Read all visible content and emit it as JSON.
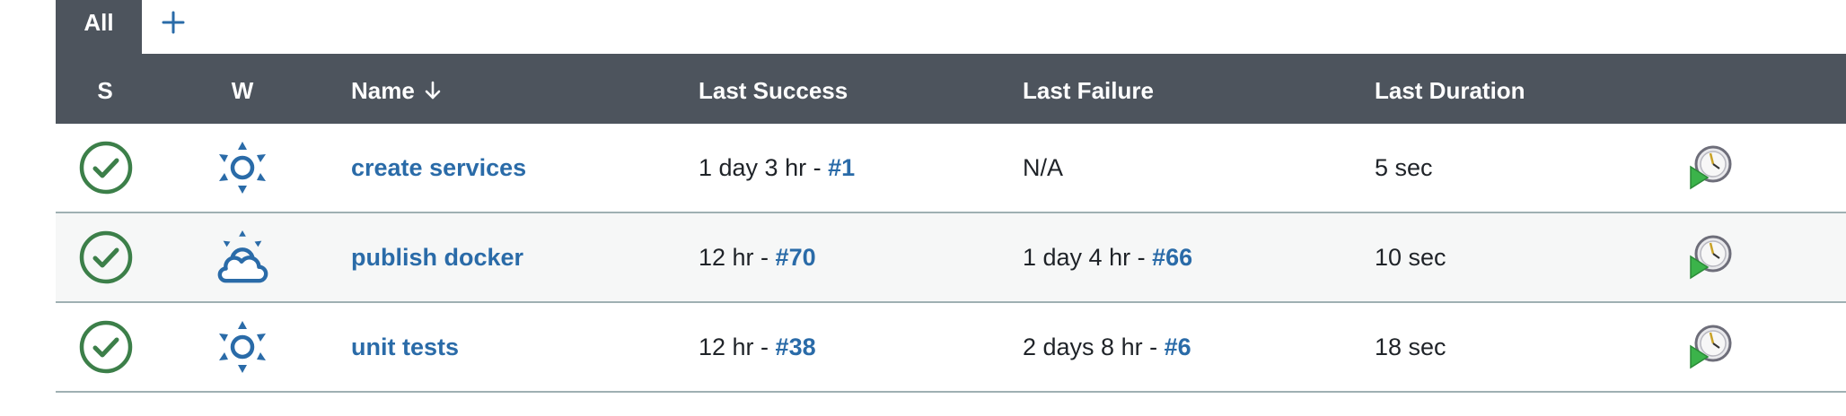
{
  "tabs": {
    "active_label": "All",
    "add_label": "+"
  },
  "header": {
    "s": "S",
    "w": "W",
    "name": "Name",
    "last_success": "Last Success",
    "last_failure": "Last Failure",
    "last_duration": "Last Duration"
  },
  "jobs": [
    {
      "status": "success",
      "weather": "sunny",
      "name": "create services",
      "last_success_time": "1 day 3 hr",
      "last_success_build": "#1",
      "last_failure_time": "N/A",
      "last_failure_build": "",
      "last_duration": "5 sec"
    },
    {
      "status": "success",
      "weather": "partly-cloudy",
      "name": "publish docker",
      "last_success_time": "12 hr",
      "last_success_build": "#70",
      "last_failure_time": "1 day 4 hr",
      "last_failure_build": "#66",
      "last_duration": "10 sec"
    },
    {
      "status": "success",
      "weather": "sunny",
      "name": "unit tests",
      "last_success_time": "12 hr",
      "last_success_build": "#38",
      "last_failure_time": "2 days 8 hr",
      "last_failure_build": "#6",
      "last_duration": "18 sec"
    }
  ],
  "separator": " - ",
  "colors": {
    "header_bg": "#4d545d",
    "link": "#2a6ba8",
    "success_green": "#3c7f49",
    "weather_blue": "#2a6ba8",
    "row_alt_bg": "#f6f7f7",
    "row_border": "#9fb0b3"
  },
  "icons": {
    "status": "success-check-icon",
    "weather_sunny": "sun-icon",
    "weather_partly_cloudy": "sun-cloud-icon",
    "action": "schedule-build-icon",
    "sort": "arrow-down-icon",
    "add": "plus-icon"
  }
}
